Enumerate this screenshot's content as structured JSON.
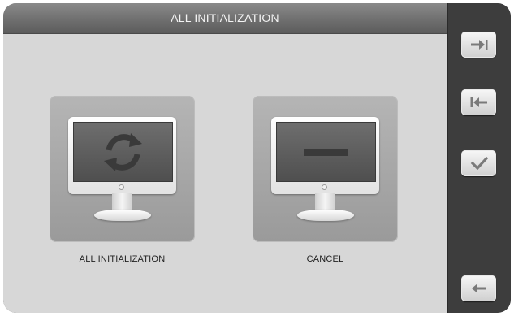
{
  "window": {
    "title": "ALL INITIALIZATION"
  },
  "options": [
    {
      "label": "ALL INITIALIZATION",
      "icon": "refresh-icon"
    },
    {
      "label": "CANCEL",
      "icon": "minus-icon"
    }
  ],
  "side_buttons": [
    {
      "icon": "arrow-right-to-bar-icon"
    },
    {
      "icon": "arrow-left-to-bar-icon"
    },
    {
      "icon": "checkmark-icon"
    },
    {
      "icon": "back-arrow-icon"
    }
  ],
  "colors": {
    "panel_background": "#d7d7d7",
    "sidebar_background": "#3d3d3d",
    "title_bar": "#6f6f6f",
    "icon_gray": "#7a7a7a"
  }
}
